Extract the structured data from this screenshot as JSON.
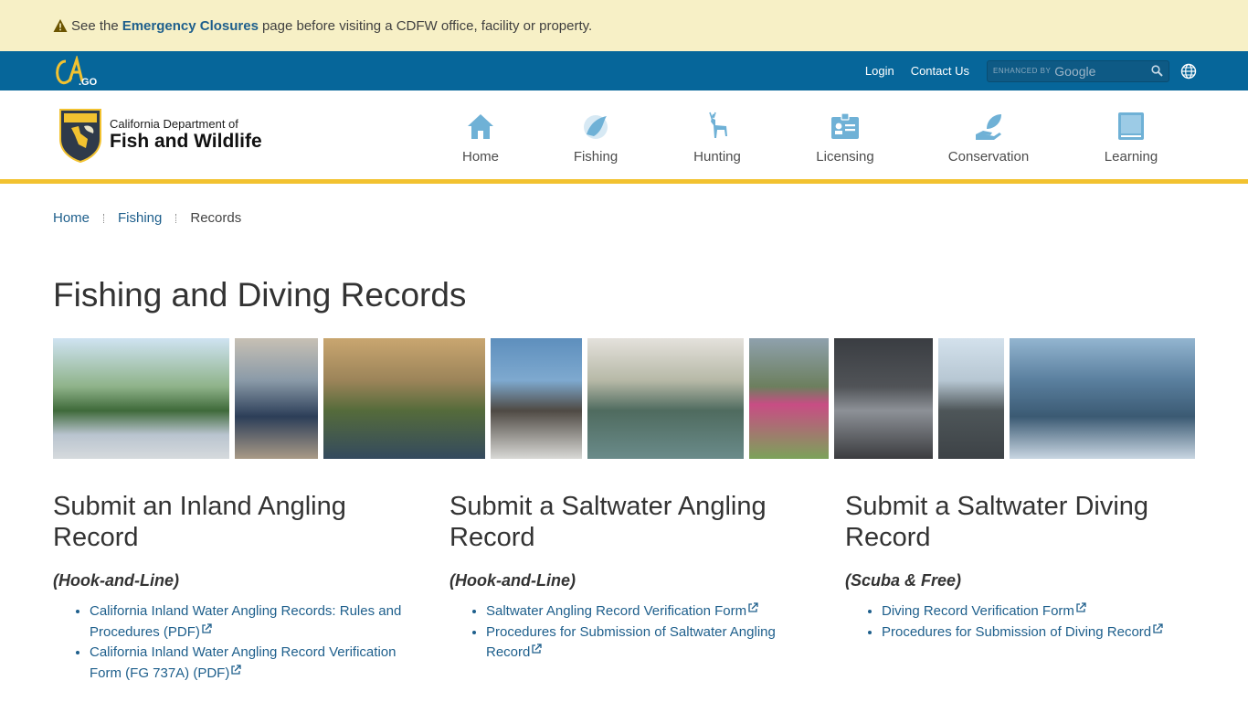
{
  "alert": {
    "prefix": "See the",
    "link": "Emergency Closures",
    "suffix": "page before visiting a CDFW office, facility or property."
  },
  "util": {
    "login": "Login",
    "contact": "Contact Us",
    "search_prefix": "ENHANCED BY",
    "search_brand": "Google"
  },
  "brand": {
    "line1": "California Department of",
    "line2": "Fish and Wildlife"
  },
  "menu": [
    {
      "label": "Home",
      "icon": "home-icon"
    },
    {
      "label": "Fishing",
      "icon": "fish-icon"
    },
    {
      "label": "Hunting",
      "icon": "deer-icon"
    },
    {
      "label": "Licensing",
      "icon": "license-card-icon"
    },
    {
      "label": "Conservation",
      "icon": "hand-leaf-icon"
    },
    {
      "label": "Learning",
      "icon": "book-icon"
    }
  ],
  "breadcrumb": {
    "home": "Home",
    "fishing": "Fishing",
    "current": "Records"
  },
  "page_title": "Fishing and Diving Records",
  "columns": [
    {
      "heading": "Submit an Inland Angling Record",
      "subheading": "(Hook-and-Line)",
      "links": [
        "California Inland Water Angling Records: Rules and Procedures (PDF)",
        "California Inland Water Angling Record Verification Form (FG 737A) (PDF)"
      ]
    },
    {
      "heading": "Submit a Saltwater Angling Record",
      "subheading": "(Hook-and-Line)",
      "links": [
        "Saltwater Angling Record Verification Form",
        "Procedures for Submission of Saltwater Angling Record"
      ]
    },
    {
      "heading": "Submit a Saltwater Diving Record",
      "subheading": "(Scuba & Free)",
      "links": [
        "Diving Record Verification Form",
        "Procedures for Submission of Diving Record"
      ]
    }
  ],
  "colors": {
    "alert_bg": "#f7f0c6",
    "util_bar": "#06669a",
    "link": "#1e5f8c",
    "nav_accent": "#f2c230",
    "icon": "#6fb1d6"
  }
}
